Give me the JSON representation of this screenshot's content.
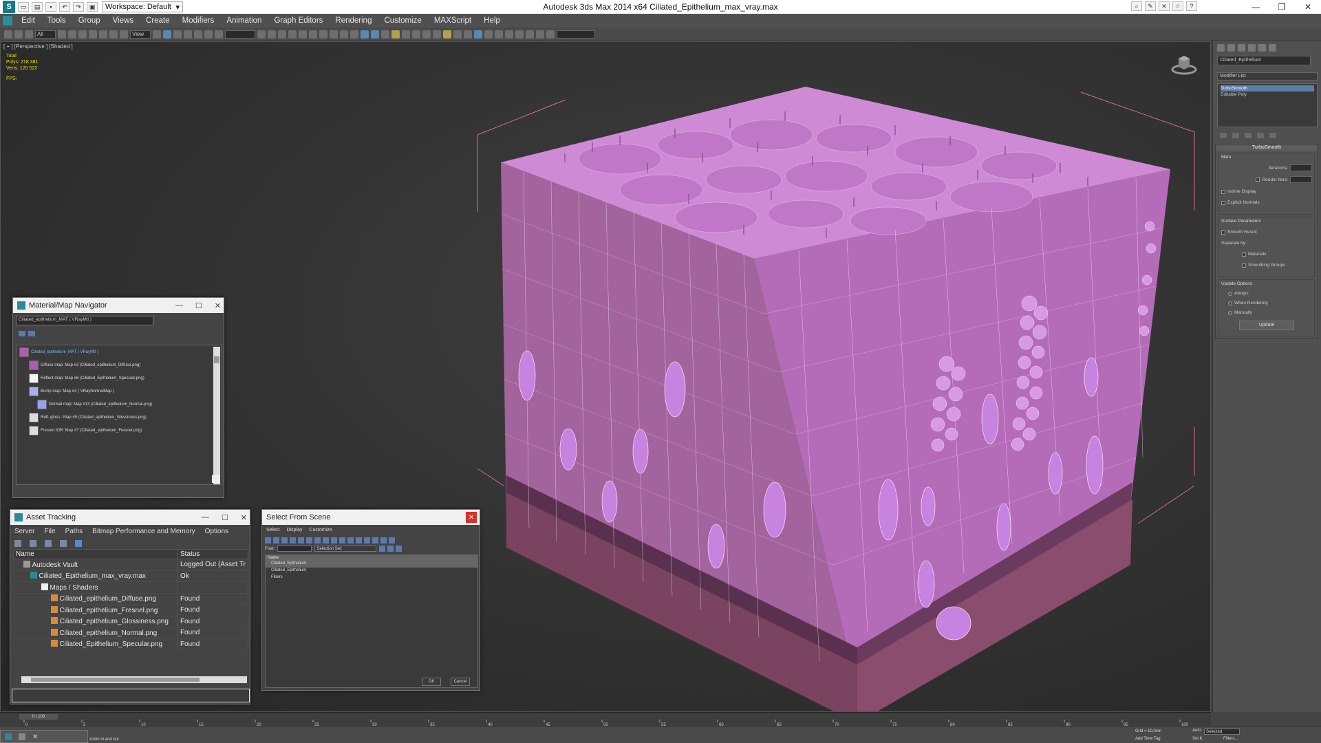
{
  "app": {
    "window_title": "Autodesk 3ds Max  2014 x64     Ciliated_Epithelium_max_vray.max",
    "workspace": "Workspace: Default"
  },
  "menu": [
    "Edit",
    "Tools",
    "Group",
    "Views",
    "Create",
    "Modifiers",
    "Animation",
    "Graph Editors",
    "Rendering",
    "Customize",
    "MAXScript",
    "Help"
  ],
  "toolbar": {
    "selection_filter": "All",
    "ref_coord": "View"
  },
  "viewport": {
    "label": "[ + ] [Perspective ] [Shaded ]",
    "stats_header": "Total",
    "stats_polys": "Polys:  218 381",
    "stats_verts": "Verts:  120 522",
    "fps": "FPS:",
    "colors": {
      "pink": "#c67bd0",
      "wire": "#f2d8f2",
      "base": "#8a4a6a",
      "box": "#d56aa0"
    }
  },
  "cmdpanel": {
    "object_name": "Ciliated_Epithelium",
    "modifier_list": "Modifier List",
    "stack": [
      "TurboSmooth",
      "Editable Poly"
    ],
    "rollout_title": "TurboSmooth",
    "main_label": "Main",
    "iterations_label": "Iterations:",
    "render_iters_label": "Render Iters:",
    "isoline_label": "Isoline Display",
    "explicit_label": "Explicit Normals",
    "surface_label": "Surface Parameters",
    "smooth_result_label": "Smooth Result",
    "separate_label": "Separate by:",
    "materials_label": "Materials",
    "smoothing_groups_label": "Smoothing Groups",
    "update_options_label": "Update Options",
    "always_label": "Always",
    "when_rendering_label": "When Rendering",
    "manually_label": "Manually",
    "update_button": "Update"
  },
  "matnav": {
    "title": "Material/Map Navigator",
    "field": "Ciliated_epithelium_MAT  ( VRayMtl )",
    "nodes": [
      "Ciliated_epithelium_MAT  ( VRayMtl )",
      "Diffuse map: Map #2 (Ciliated_epithelium_Diffuse.png)",
      "Reflect map: Map #6 (Ciliated_Epithelium_Specular.png)",
      "Bump map: Map #4  ( VRayNormalMap )",
      "Normal map: Map #13 (Ciliated_epithelium_Normal.png)",
      "Refl. gloss.: Map #5 (Ciliated_epithelium_Glossiness.png)",
      "Fresnel IOR: Map #7 (Ciliated_epithelium_Fresnel.png)"
    ]
  },
  "asset": {
    "title": "Asset Tracking",
    "menu": [
      "Server",
      "File",
      "Paths",
      "Bitmap Performance and Memory",
      "Options"
    ],
    "columns": [
      "Name",
      "Status"
    ],
    "rows": [
      {
        "name": "Autodesk Vault",
        "status": "Logged Out (Asset Tr"
      },
      {
        "name": "Ciliated_Epithelium_max_vray.max",
        "status": "Ok"
      },
      {
        "name": "Maps / Shaders",
        "status": ""
      },
      {
        "name": "Ciliated_epithelium_Diffuse.png",
        "status": "Found"
      },
      {
        "name": "Ciliated_epithelium_Fresnel.png",
        "status": "Found"
      },
      {
        "name": "Ciliated_epithelium_Glossiness.png",
        "status": "Found"
      },
      {
        "name": "Ciliated_epithelium_Normal.png",
        "status": "Found"
      },
      {
        "name": "Ciliated_Epithelium_Specular.png",
        "status": "Found"
      }
    ]
  },
  "selscene": {
    "title": "Select From Scene",
    "menu": [
      "Select",
      "Display",
      "Customize"
    ],
    "find_label": "Find:",
    "selection_set": "Selection Set:",
    "header": "Name",
    "items": [
      "Ciliated_Epithelium",
      "Ciliated_Epithelium",
      "Fibers"
    ],
    "ok": "OK",
    "cancel": "Cancel"
  },
  "timeline": {
    "frame": "0 / 100",
    "ticks": [
      "0",
      "5",
      "10",
      "15",
      "20",
      "25",
      "30",
      "35",
      "40",
      "45",
      "50",
      "55",
      "60",
      "65",
      "70",
      "75",
      "80",
      "85",
      "90",
      "95",
      "100"
    ]
  },
  "status": {
    "prompt": "zoom in and out",
    "grid": "Grid = 10,0cm",
    "add_time_tag": "Add Time Tag",
    "auto": "Auto",
    "set_k": "Set K.",
    "selected": "Selected",
    "filters": "Filters..."
  }
}
